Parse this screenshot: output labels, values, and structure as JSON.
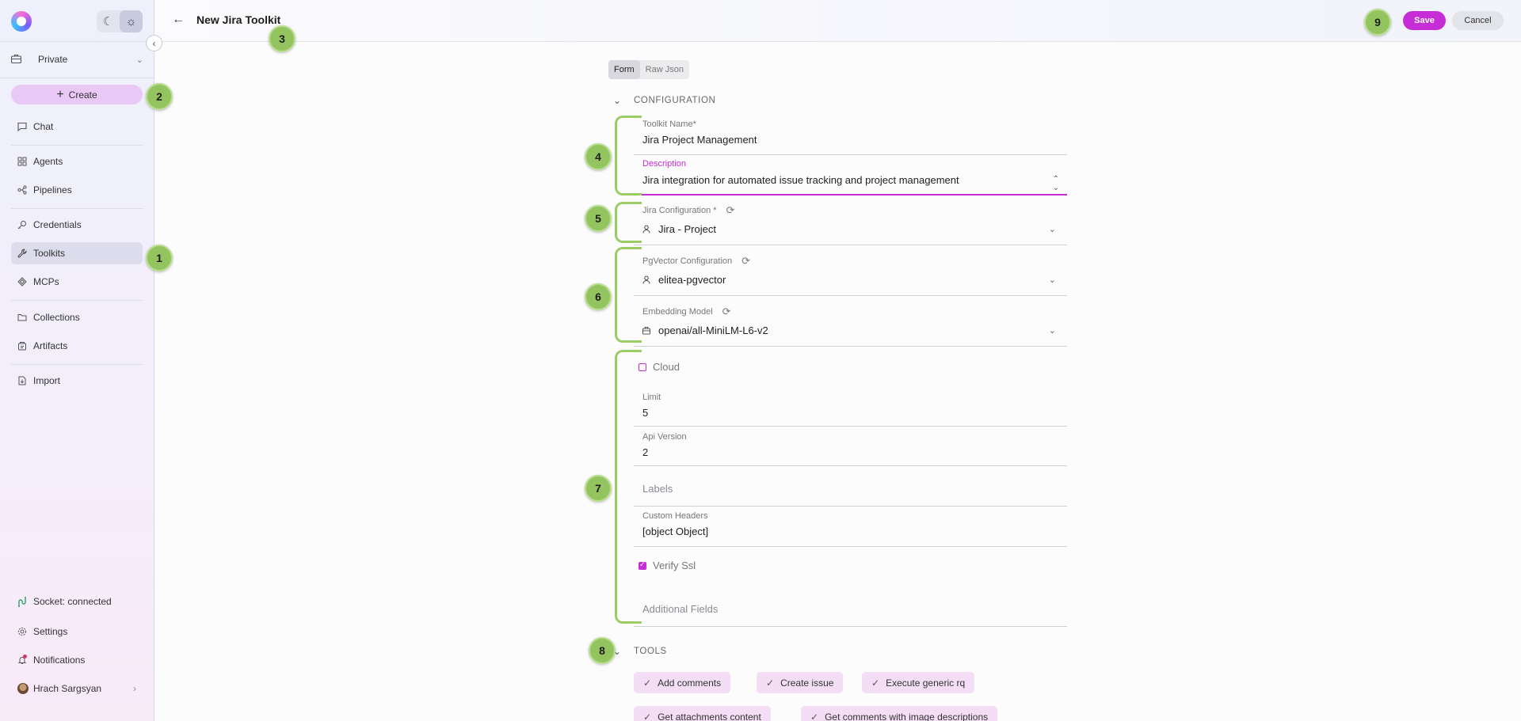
{
  "sidebar": {
    "project": "Private",
    "create_label": "Create",
    "items": [
      {
        "label": "Chat",
        "icon": "chat-icon"
      },
      {
        "label": "Agents",
        "icon": "grid-icon"
      },
      {
        "label": "Pipelines",
        "icon": "pipeline-icon"
      },
      {
        "label": "Credentials",
        "icon": "key-icon"
      },
      {
        "label": "Toolkits",
        "icon": "wrench-icon",
        "active": true
      },
      {
        "label": "MCPs",
        "icon": "mcp-icon"
      },
      {
        "label": "Collections",
        "icon": "folder-icon"
      },
      {
        "label": "Artifacts",
        "icon": "artifact-icon"
      },
      {
        "label": "Import",
        "icon": "import-icon"
      }
    ],
    "bottom": {
      "socket": "Socket: connected",
      "settings": "Settings",
      "notifications": "Notifications",
      "user": "Hrach Sargsyan"
    }
  },
  "header": {
    "title": "New Jira Toolkit",
    "save_label": "Save",
    "cancel_label": "Cancel"
  },
  "form": {
    "tabs": [
      "Form",
      "Raw Json"
    ],
    "active_tab": "Form",
    "configuration_title": "CONFIGURATION",
    "toolkit_name": {
      "label": "Toolkit Name*",
      "value": "Jira Project Management"
    },
    "description": {
      "label": "Description",
      "value": "Jira integration for automated issue tracking and project management"
    },
    "jira_configuration": {
      "label": "Jira Configuration *",
      "value": "Jira - Project"
    },
    "pgvector_configuration": {
      "label": "PgVector Configuration",
      "value": "elitea-pgvector"
    },
    "embedding_model": {
      "label": "Embedding Model",
      "value": "openai/all-MiniLM-L6-v2"
    },
    "cloud": {
      "label": "Cloud",
      "checked": false
    },
    "limit": {
      "label": "Limit",
      "value": "5"
    },
    "api_version": {
      "label": "Api Version",
      "value": "2"
    },
    "labels": {
      "placeholder": "Labels"
    },
    "custom_headers": {
      "label": "Custom Headers",
      "value": "[object Object]"
    },
    "verify_ssl": {
      "label": "Verify Ssl",
      "checked": true
    },
    "additional_fields": {
      "placeholder": "Additional Fields"
    },
    "tools_title": "TOOLS",
    "tools": [
      "Add comments",
      "Create issue",
      "Execute generic rq",
      "Get attachments content",
      "Get comments with image descriptions"
    ]
  },
  "annotations": [
    "1",
    "2",
    "3",
    "4",
    "5",
    "6",
    "7",
    "8",
    "9"
  ],
  "colors": {
    "accent": "#c72dd6",
    "annotation": "#93c460",
    "active_nav": "#dcdced"
  }
}
